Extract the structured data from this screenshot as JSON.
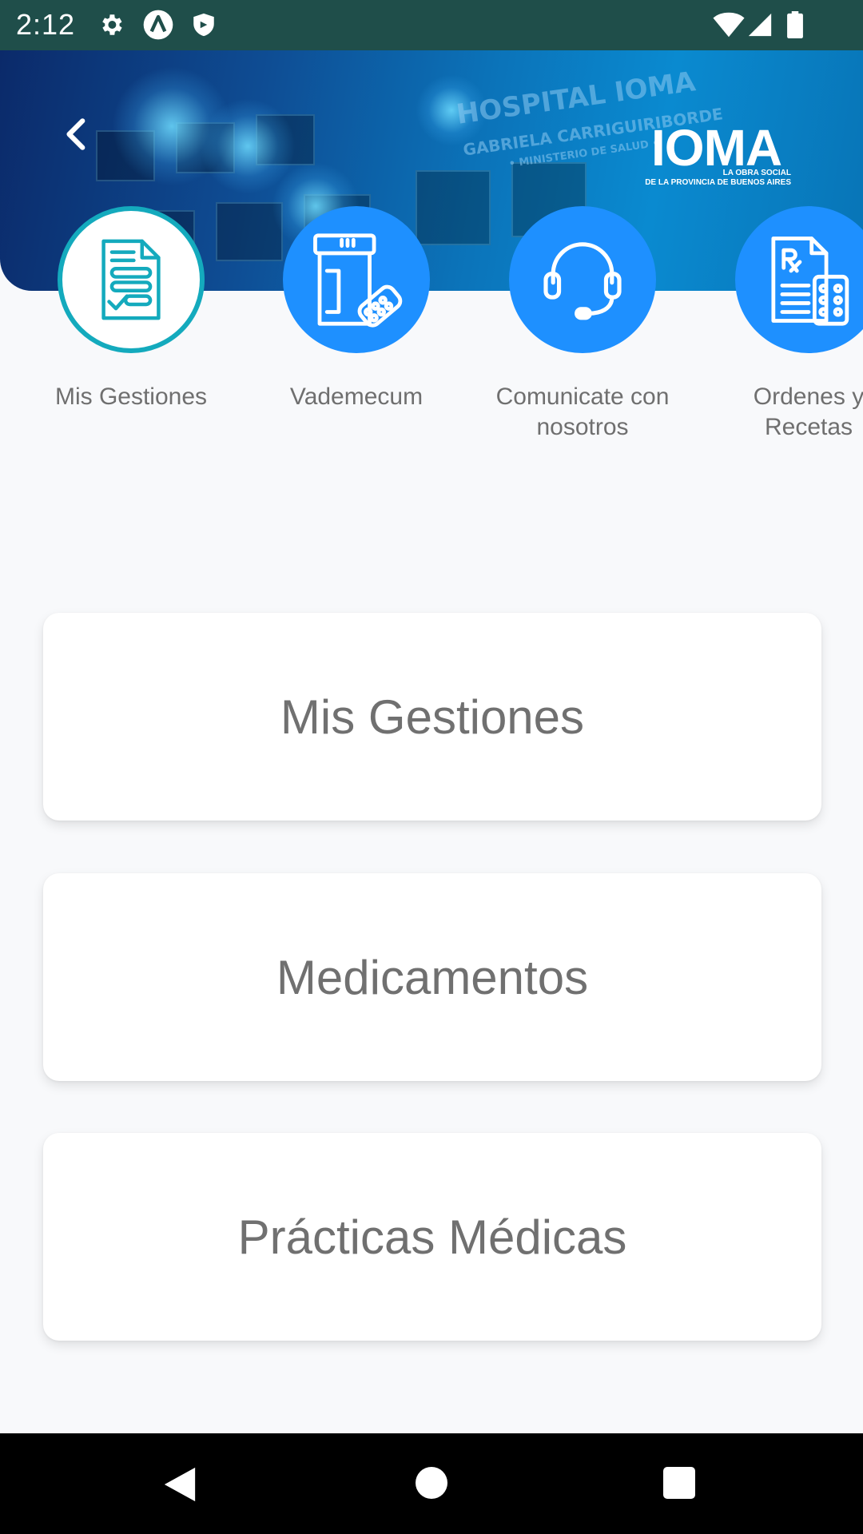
{
  "status_bar": {
    "time": "2:12",
    "icons": [
      "gear-icon",
      "app-a-icon",
      "shield-icon",
      "wifi-icon",
      "signal-icon",
      "battery-icon"
    ]
  },
  "header": {
    "back_icon": "chevron-left-icon",
    "building_sign": {
      "line1": "HOSPITAL IOMA",
      "line2": "GABRIELA CARRIGUIRIBORDE",
      "line3": "• MINISTERIO DE SALUD •"
    },
    "logo": {
      "name": "IOMA",
      "line1": "LA OBRA SOCIAL",
      "line2": "DE LA PROVINCIA DE BUENOS AIRES"
    }
  },
  "quick_access": [
    {
      "label_line1": "Mis Gestiones",
      "label_line2": "",
      "icon": "document-check-icon",
      "active": true
    },
    {
      "label_line1": "Vademecum",
      "label_line2": "",
      "icon": "pill-bottle-icon",
      "active": false
    },
    {
      "label_line1": "Comunicate con",
      "label_line2": "nosotros",
      "icon": "headset-icon",
      "active": false
    },
    {
      "label_line1": "Ordenes y",
      "label_line2": "Recetas",
      "icon": "prescription-icon",
      "active": false
    }
  ],
  "cards": [
    "Mis Gestiones",
    "Medicamentos",
    "Prácticas Médicas"
  ],
  "colors": {
    "status_bar": "#1f4e4a",
    "primary_blue": "#1e90ff",
    "active_ring": "#14aabd",
    "card_text": "#707070"
  },
  "nav_bar": {
    "icons": [
      "back-triangle-icon",
      "home-circle-icon",
      "recents-square-icon"
    ]
  }
}
